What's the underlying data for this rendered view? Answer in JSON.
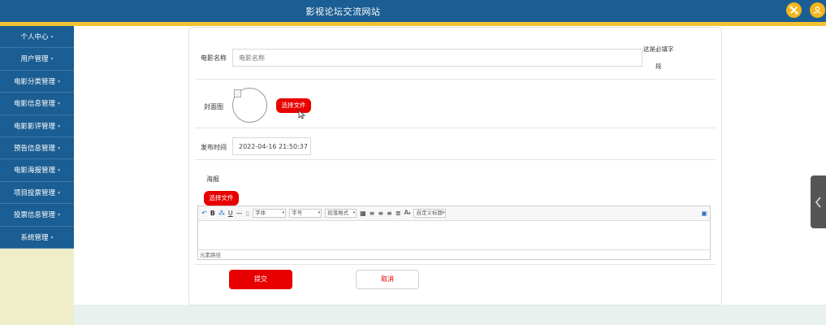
{
  "header": {
    "title": "影视论坛交流网站",
    "icons": [
      "close-icon",
      "user-icon"
    ],
    "brand_color": "#1b5e93",
    "accent_color": "#f2c230"
  },
  "sidebar": {
    "items": [
      {
        "label": "个人中心"
      },
      {
        "label": "用户管理"
      },
      {
        "label": "电影分类管理"
      },
      {
        "label": "电影信息管理"
      },
      {
        "label": "电影影评管理"
      },
      {
        "label": "预告信息管理"
      },
      {
        "label": "电影海报管理"
      },
      {
        "label": "项目投票管理"
      },
      {
        "label": "投票信息管理"
      },
      {
        "label": "系统管理"
      }
    ]
  },
  "form": {
    "movie_name": {
      "label": "电影名称",
      "placeholder": "电影名称",
      "value": "",
      "required_hint_line1": "这是必填字",
      "required_hint_line2": "段"
    },
    "cover": {
      "label": "封面图",
      "choose_file_label": "选择文件"
    },
    "publish_time": {
      "label": "发布时间",
      "value": "2022-04-16 21:50:37"
    },
    "poster": {
      "label": "海报",
      "choose_file_label": "选择文件"
    },
    "editor": {
      "toolbar": {
        "bold": "B",
        "underline": "U",
        "font_family": "字体",
        "font_size": "字号",
        "paragraph_format": "段落格式",
        "font_color": "A",
        "custom_title": "自定义标题"
      },
      "status_path": "元素路径"
    },
    "submit_label": "提交",
    "cancel_label": "取消"
  }
}
